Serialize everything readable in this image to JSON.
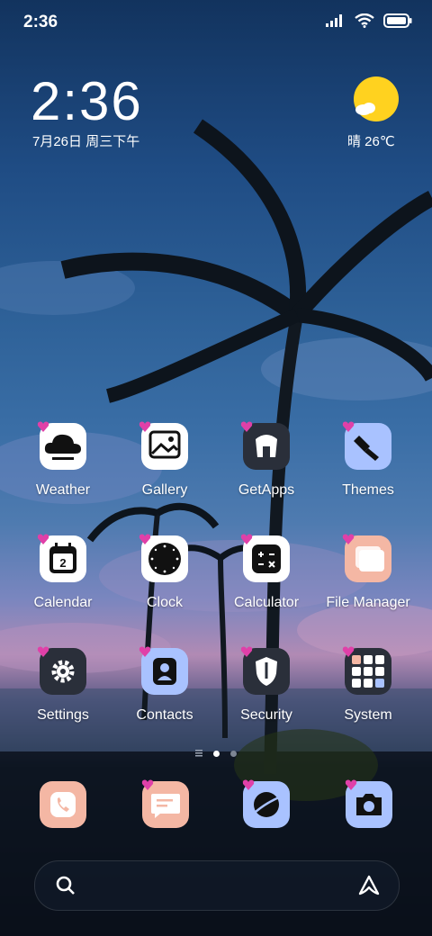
{
  "status_bar": {
    "time": "2:36"
  },
  "clock_widget": {
    "time": "2:36",
    "date": "7月26日 周三下午"
  },
  "weather_widget": {
    "text": "晴 26℃"
  },
  "apps": [
    {
      "label": "Weather",
      "bg": "#ffffff",
      "icon": "cloud-icon"
    },
    {
      "label": "Gallery",
      "bg": "#ffffff",
      "icon": "image-icon"
    },
    {
      "label": "GetApps",
      "bg": "#2a2f3a",
      "icon": "store-icon"
    },
    {
      "label": "Themes",
      "bg": "#a9c2ff",
      "icon": "brush-icon"
    },
    {
      "label": "Calendar",
      "bg": "#ffffff",
      "icon": "calendar-icon"
    },
    {
      "label": "Clock",
      "bg": "#ffffff",
      "icon": "clock-icon"
    },
    {
      "label": "Calculator",
      "bg": "#ffffff",
      "icon": "calculator-icon"
    },
    {
      "label": "File Manager",
      "bg": "#f4b7a4",
      "icon": "folder-icon"
    },
    {
      "label": "Settings",
      "bg": "#2a2f3a",
      "icon": "gear-icon"
    },
    {
      "label": "Contacts",
      "bg": "#a9c2ff",
      "icon": "contact-icon"
    },
    {
      "label": "Security",
      "bg": "#2a2f3a",
      "icon": "shield-icon"
    },
    {
      "label": "System",
      "bg": "#2a2f3a",
      "icon": "folder-grid-icon"
    }
  ],
  "dock": [
    {
      "name": "phone",
      "bg": "#f4b7a4",
      "icon": "phone-icon"
    },
    {
      "name": "messages",
      "bg": "#f4b7a4",
      "icon": "message-icon"
    },
    {
      "name": "browser",
      "bg": "#a9c2ff",
      "icon": "planet-icon"
    },
    {
      "name": "camera",
      "bg": "#a9c2ff",
      "icon": "camera-icon"
    }
  ],
  "page_indicator": {
    "pages": 2,
    "current": 1
  }
}
